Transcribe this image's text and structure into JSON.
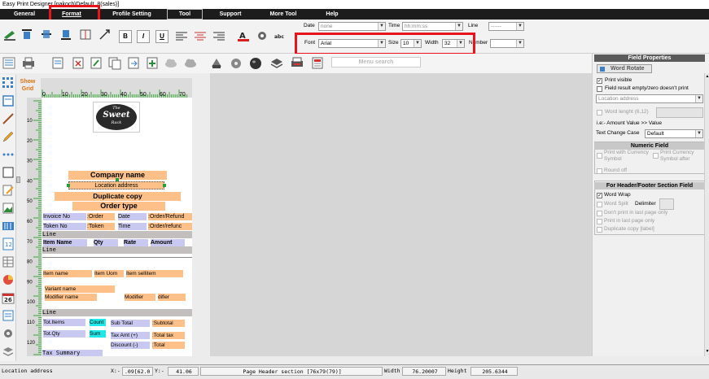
{
  "window": {
    "title": "Easy Print Designer [nakoch\\Default_8(sales)]"
  },
  "menubar": {
    "items": [
      "General",
      "Format",
      "Profile Setting",
      "Tool",
      "Support",
      "More Tool",
      "Help"
    ]
  },
  "toolbar": {
    "date_label": "Date",
    "date_value": "none",
    "time_label": "Time",
    "time_value": "hh:mm:ss",
    "line_label": "Line",
    "line_value": "------",
    "font_label": "Font",
    "font_value": "Arial",
    "size_label": "Size",
    "size_value": "10",
    "width_label": "Width",
    "width_value": "32",
    "number_label": "Number",
    "number_value": ""
  },
  "menu_search": {
    "label": "Menu search"
  },
  "canvas": {
    "show_grid": "Show Grid",
    "hruler_labels": [
      "0",
      "10",
      "20",
      "30",
      "40",
      "50",
      "60",
      "70"
    ],
    "vruler_labels": [
      "10",
      "20",
      "30",
      "40",
      "50",
      "60",
      "70",
      "80",
      "90",
      "100",
      "110",
      "120"
    ],
    "logo_text": [
      "The",
      "Sweet",
      "Rack"
    ],
    "fields": {
      "company_name": "Company name",
      "location_address": "Location address",
      "duplicate_copy": "Duplicate copy",
      "order_type": "Order type",
      "invoice_no": "Invoice No",
      "order": ":Order",
      "date": "Date",
      "order_refund": ":Order/Refund",
      "token_no": "Token No",
      "token": ":Token",
      "time": "Time",
      "order_refund_2": ":Order/refunc",
      "line": "Line",
      "item_name_hdr": "Item Name",
      "qty_hdr": "Qty",
      "rate_hdr": "Rate",
      "amount_hdr": "Amount",
      "item_name": "Item name",
      "item_uom": "Item Uom",
      "item_sellitem": "Item sellitem",
      "variant_name": "Variant name",
      "modifier_name": "Modifier name",
      "modifier": "Modifier",
      "difier": "difier",
      "tot_items": "Tot.Items",
      "count": "Count",
      "sub_total": "Sub Total",
      "subtotal": ":Subtotal",
      "tot_qty": "Tot.Qty",
      "sum": "Sum",
      "tax_amt": "Tax Amt  (+)",
      "total_tax": ":Total tax",
      "discount": "Discount  (-)",
      "total": ":Total",
      "tax_summary": "Tax Summary"
    }
  },
  "properties": {
    "title": "Field Properties",
    "word_rotate": "Word Rotate",
    "print_visible": "Print visible",
    "field_empty": "Field result empty/zero doesn't print",
    "location_address": "Location address",
    "word_lenght": "Word lenght (6,12)",
    "ie_text": "i.e:- Amount Value >> Value",
    "text_change_case": "Text Change Case",
    "case_value": "Default",
    "numeric_title": "Numeric Field",
    "print_with_currency": "Print with Currency Symbol",
    "print_currency_after": "Print Currency Symbol after",
    "round_off": "Round off",
    "header_footer_title": "For Header/Footer Section Field",
    "word_wrap": "Word Wrap",
    "word_split": "Word Split",
    "delimiter": "Delimiter",
    "dont_print_last": "Don't print in last page only",
    "print_last_only": "Print in last page only",
    "duplicate_copy_label": "Duplicate copy [label]"
  },
  "statusbar": {
    "field": "Location address",
    "x_label": "X:-",
    "x_value": ".09[62.0",
    "y_label": "Y:-",
    "y_value": "41.06",
    "section": "Page Header section [76x79(79)]",
    "width_label": "Width",
    "width_value": "76.20007",
    "height_label": "Height",
    "height_value": "205.6344"
  }
}
